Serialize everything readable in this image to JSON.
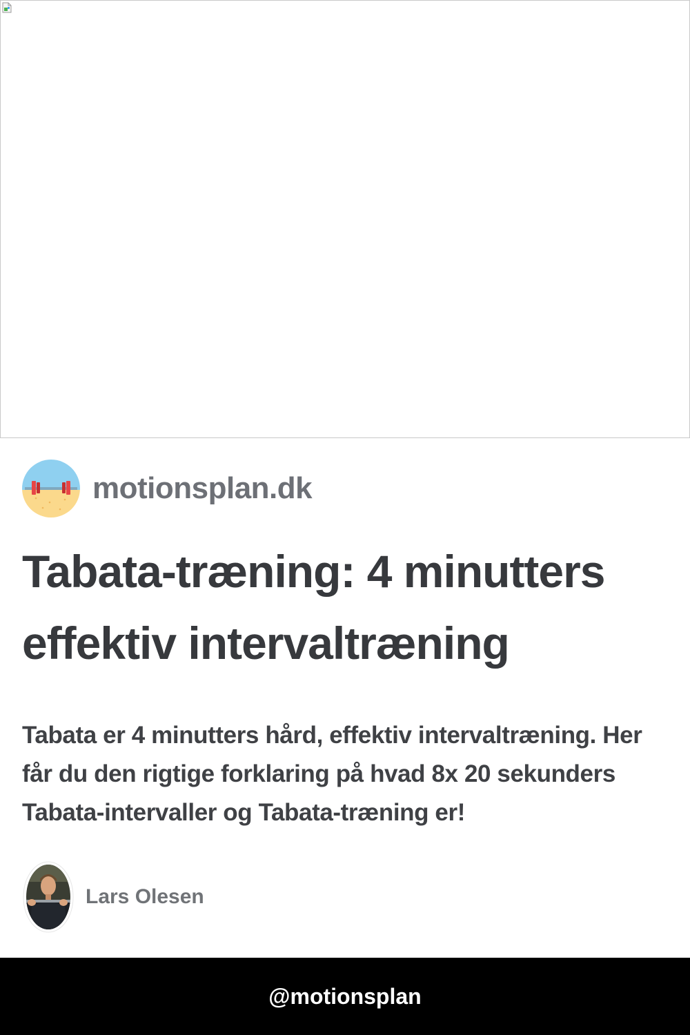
{
  "site": {
    "name": "motionsplan.dk",
    "logo_icon": "barbell-logo-icon"
  },
  "article": {
    "title": "Tabata-træning: 4 minutters effektiv intervaltræning",
    "description": "Tabata er 4 minutters hård, effektiv intervaltræning. Her får du den rigtige forklaring på hvad 8x 20 sekunders Tabata-intervaller og Tabata-træning er!"
  },
  "author": {
    "name": "Lars Olesen"
  },
  "footer": {
    "handle": "@motionsplan"
  },
  "colors": {
    "site_name": "#6d7076",
    "title": "#37393d",
    "footer_background": "#000000"
  }
}
